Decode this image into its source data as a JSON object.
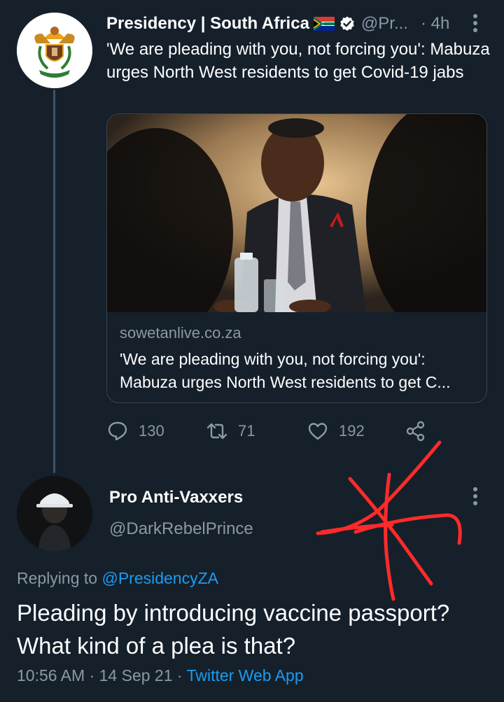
{
  "tweet": {
    "author_name": "Presidency | South Africa",
    "author_handle": "@Pr...",
    "timestamp": "· 4h",
    "text": "'We are pleading with you, not forcing you': Mabuza urges North West residents to get Covid-19 jabs",
    "card": {
      "domain": "sowetanlive.co.za",
      "title": "'We are pleading with you, not forcing you': Mabuza urges North West residents to get C..."
    },
    "actions": {
      "replies": "130",
      "retweets": "71",
      "likes": "192"
    }
  },
  "reply": {
    "author_name": "Pro Anti-Vaxxers",
    "author_handle": "@DarkRebelPrince",
    "replying_prefix": "Replying to",
    "replying_to": "@PresidencyZA",
    "text": "Pleading by introducing vaccine passport? What kind of a plea is that?",
    "time": "10:56 AM",
    "date": "14 Sep 21",
    "source": "Twitter Web App"
  },
  "colors": {
    "background": "#15202b",
    "muted": "#8b98a5",
    "link": "#1d9bf0",
    "scribble": "#ff2a2a"
  }
}
